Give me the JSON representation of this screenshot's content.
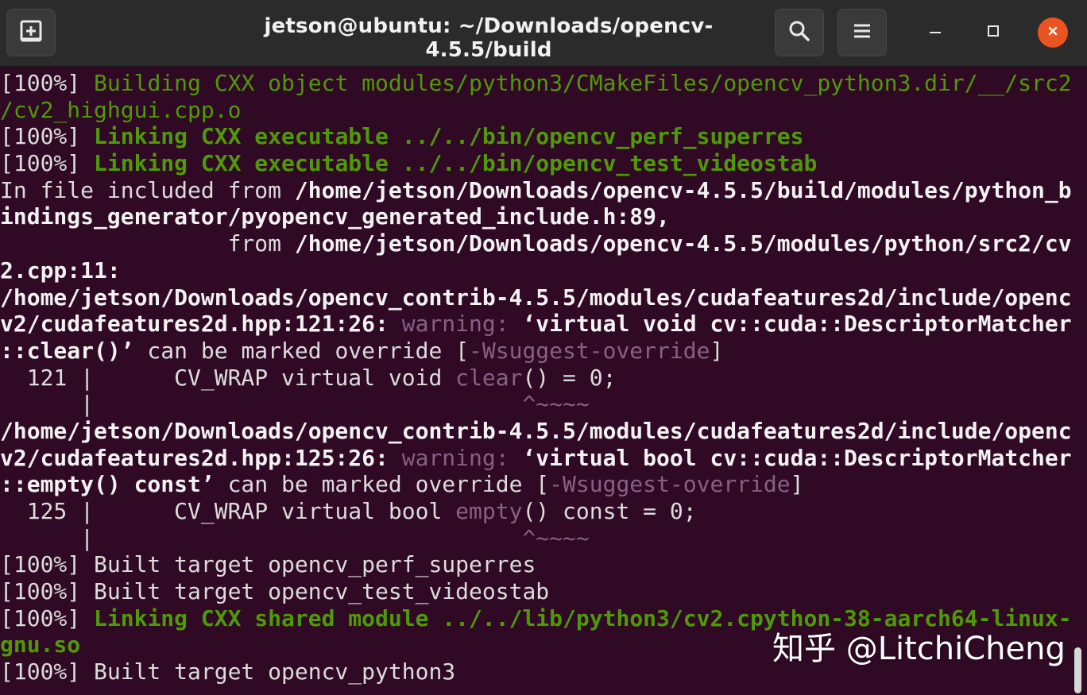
{
  "window": {
    "title": "jetson@ubuntu: ~/Downloads/opencv-4.5.5/build",
    "icons": {
      "new_tab": "new-tab-icon",
      "search": "search-icon",
      "menu": "hamburger-menu-icon",
      "minimize": "minimize-icon",
      "maximize": "maximize-icon",
      "close": "close-icon"
    },
    "colors": {
      "background": "#300a24",
      "green": "#4e9a06",
      "warning": "#8a5f86",
      "close": "#e95420"
    }
  },
  "terminal": {
    "l1a": "[100%] ",
    "l1b": "Building CXX object modules/python3/CMakeFiles/opencv_python3.dir/__/src2",
    "l2": "/cv2_highgui.cpp.o",
    "l3a": "[100%] ",
    "l3b": "Linking CXX executable ../../bin/opencv_perf_superres",
    "l4a": "[100%] ",
    "l4b": "Linking CXX executable ../../bin/opencv_test_videostab",
    "l5a": "In file included from ",
    "l5b": "/home/jetson/Downloads/opencv-4.5.5/build/modules/python_b",
    "l6": "indings_generator/pyopencv_generated_include.h:89,",
    "l7a": "                 from ",
    "l7b": "/home/jetson/Downloads/opencv-4.5.5/modules/python/src2/cv",
    "l8": "2.cpp:11:",
    "l9": "/home/jetson/Downloads/opencv_contrib-4.5.5/modules/cudafeatures2d/include/openc",
    "l10a": "v2/cudafeatures2d.hpp:121:26: ",
    "l10b": "warning: ",
    "l10c": "‘virtual void cv::cuda::DescriptorMatcher",
    "l11a": "::clear()’",
    "l11b": " can be marked override [",
    "l11c": "-Wsuggest-override",
    "l11d": "]",
    "l12a": "  121 |      CV_WRAP virtual void ",
    "l12b": "clear",
    "l12c": "() = 0;",
    "l13a": "      |                          ",
    "l13b": "      ^~~~~",
    "l14": "/home/jetson/Downloads/opencv_contrib-4.5.5/modules/cudafeatures2d/include/openc",
    "l15a": "v2/cudafeatures2d.hpp:125:26: ",
    "l15b": "warning: ",
    "l15c": "‘virtual bool cv::cuda::DescriptorMatcher",
    "l16a": "::empty() const’",
    "l16b": " can be marked override [",
    "l16c": "-Wsuggest-override",
    "l16d": "]",
    "l17a": "  125 |      CV_WRAP virtual bool ",
    "l17b": "empty",
    "l17c": "() const = 0;",
    "l18a": "      |                          ",
    "l18b": "      ^~~~~",
    "l19": "[100%] Built target opencv_perf_superres",
    "l20": "[100%] Built target opencv_test_videostab",
    "l21a": "[100%] ",
    "l21b": "Linking CXX shared module ../../lib/python3/cv2.cpython-38-aarch64-linux-",
    "l22": "gnu.so",
    "l23": "[100%] Built target opencv_python3"
  },
  "watermark": "知乎 @LitchiCheng"
}
